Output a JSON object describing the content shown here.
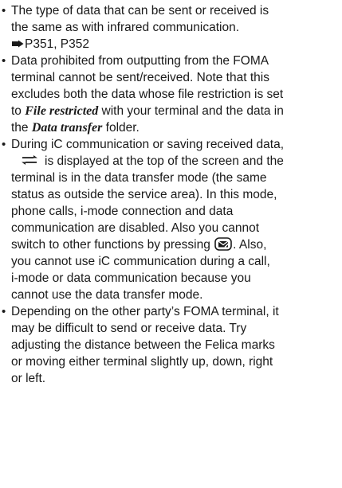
{
  "bullets": [
    {
      "lines": [
        "The type of data that can be sent or received is",
        "the same as with infrared communication.",
        "P351, P352"
      ]
    },
    {
      "lines": [
        "Data prohibited from outputting from the FOMA",
        "terminal cannot be sent/received. Note that this",
        "excludes both the data whose file restriction is set",
        "to",
        "File restricted",
        "with your terminal and the data in",
        "the",
        "Data transfer",
        "folder."
      ]
    },
    {
      "lines": [
        "During iC communication or saving received data,",
        "is displayed at the top of the screen and the",
        "terminal is in the data transfer mode (the same",
        "status as outside the service area). In this mode,",
        "phone calls, i-mode connection and data",
        "communication are disabled. Also you cannot",
        "switch to other functions by pressing",
        ". Also,",
        "you cannot use iC communication during a call,",
        "i-mode or data communication because you",
        "cannot use the data transfer mode."
      ]
    },
    {
      "lines": [
        "Depending on the other party’s FOMA terminal, it",
        "may be difficult to send or receive data. Try",
        "adjusting the distance between the Felica marks",
        "or moving either terminal slightly up, down, right",
        "or left."
      ]
    }
  ],
  "icons": {
    "bullet": "•",
    "reference": "pointing-hand-icon",
    "transfer": "data-transfer-icon",
    "key": "mail-key-icon"
  }
}
